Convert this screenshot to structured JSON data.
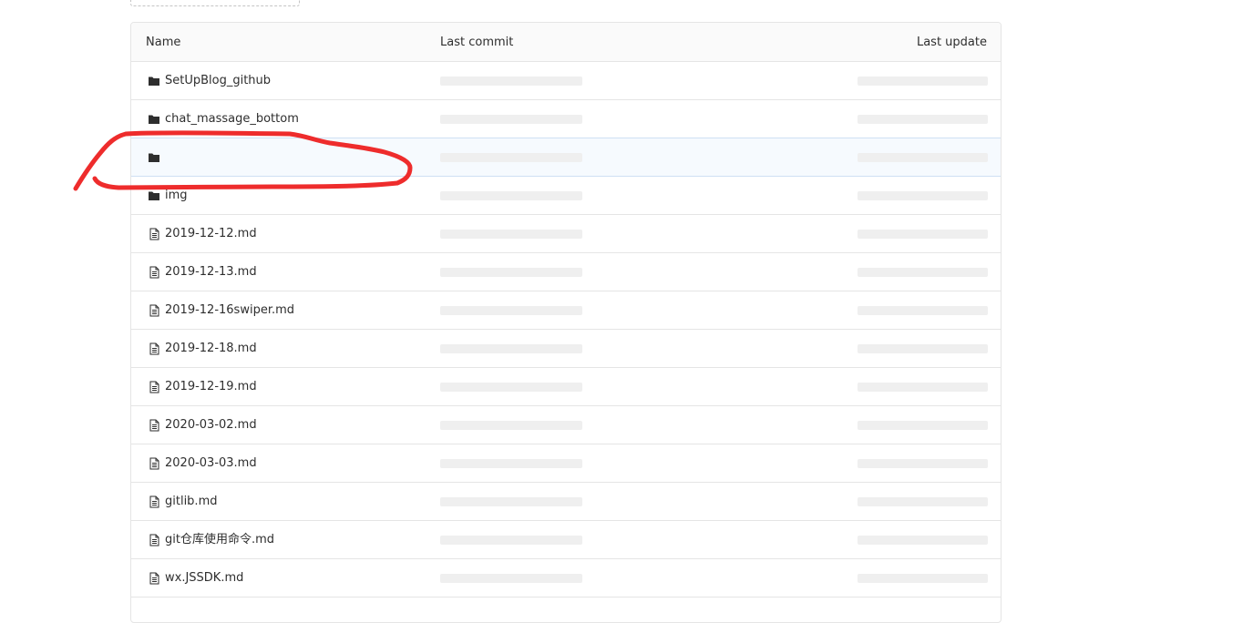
{
  "table": {
    "headers": {
      "name": "Name",
      "last_commit": "Last commit",
      "last_update": "Last update"
    },
    "rows": [
      {
        "type": "folder",
        "icon": "folder-icon",
        "name": "SetUpBlog_github"
      },
      {
        "type": "folder",
        "icon": "folder-icon",
        "name": "chat_massage_bottom"
      },
      {
        "type": "folder",
        "icon": "folder-icon",
        "name": "",
        "highlighted": true
      },
      {
        "type": "folder",
        "icon": "folder-icon",
        "name": "img"
      },
      {
        "type": "file",
        "icon": "file-icon",
        "name": "2019-12-12.md"
      },
      {
        "type": "file",
        "icon": "file-icon",
        "name": "2019-12-13.md"
      },
      {
        "type": "file",
        "icon": "file-icon",
        "name": "2019-12-16swiper.md"
      },
      {
        "type": "file",
        "icon": "file-icon",
        "name": "2019-12-18.md"
      },
      {
        "type": "file",
        "icon": "file-icon",
        "name": "2019-12-19.md"
      },
      {
        "type": "file",
        "icon": "file-icon",
        "name": "2020-03-02.md"
      },
      {
        "type": "file",
        "icon": "file-icon",
        "name": "2020-03-03.md"
      },
      {
        "type": "file",
        "icon": "file-icon",
        "name": "gitlib.md"
      },
      {
        "type": "file",
        "icon": "file-icon",
        "name": "git仓库使用命令.md"
      },
      {
        "type": "file",
        "icon": "file-icon",
        "name": "wx.JSSDK.md"
      }
    ]
  },
  "annotation": {
    "color": "#ee2c2c"
  }
}
